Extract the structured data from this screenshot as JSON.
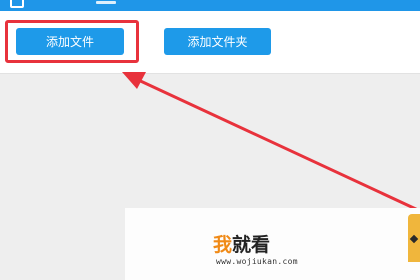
{
  "toolbar": {
    "add_file_label": "添加文件",
    "add_folder_label": "添加文件夹"
  },
  "watermark": {
    "logo_accent": "我",
    "logo_rest": "就看",
    "url": "www.wojiukan.com"
  },
  "colors": {
    "titlebar": "#1f96e8",
    "button": "#1e9ae9",
    "highlight": "#e8323c",
    "logo_accent": "#f08a17"
  },
  "icons": [
    "window-icon",
    "annotation-arrow-icon",
    "corner-icon"
  ]
}
